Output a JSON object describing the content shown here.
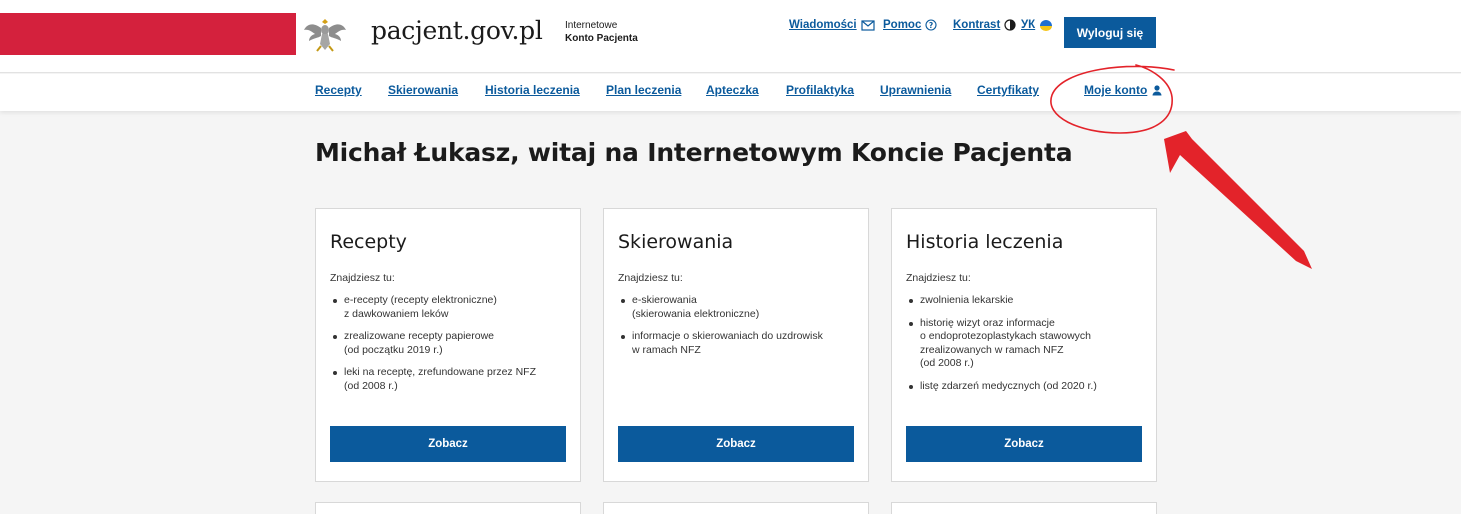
{
  "header": {
    "brand": "pacjent.gov.pl",
    "subtitle_line1": "Internetowe",
    "subtitle_line2": "Konto Pacjenta",
    "links": {
      "messages": "Wiadomości",
      "help": "Pomoc",
      "contrast": "Kontrast",
      "language": "УК"
    },
    "logout_label": "Wyloguj się",
    "brand_red": "#d4213d",
    "accent_blue": "#0b5a9c"
  },
  "nav": {
    "items": [
      {
        "label": "Recepty"
      },
      {
        "label": "Skierowania"
      },
      {
        "label": "Historia leczenia"
      },
      {
        "label": "Plan leczenia"
      },
      {
        "label": "Apteczka"
      },
      {
        "label": "Profilaktyka"
      },
      {
        "label": "Uprawnienia"
      },
      {
        "label": "Certyfikaty"
      },
      {
        "label": "Moje konto"
      }
    ]
  },
  "main": {
    "title": "Michał Łukasz, witaj na Internetowym Koncie Pacjenta",
    "cards": [
      {
        "title": "Recepty",
        "intro": "Znajdziesz tu:",
        "items": [
          "e-recepty (recepty elektroniczne)\nz dawkowaniem leków",
          "zrealizowane recepty papierowe\n(od początku 2019 r.)",
          "leki na receptę, zrefundowane przez NFZ\n(od 2008 r.)"
        ],
        "button": "Zobacz"
      },
      {
        "title": "Skierowania",
        "intro": "Znajdziesz tu:",
        "items": [
          "e-skierowania\n(skierowania elektroniczne)",
          "informacje o skierowaniach do uzdrowisk\nw ramach NFZ"
        ],
        "button": "Zobacz"
      },
      {
        "title": "Historia leczenia",
        "intro": "Znajdziesz tu:",
        "items": [
          "zwolnienia lekarskie",
          "historię wizyt oraz informacje\no endoprotezoplastykach stawowych\nzrealizowanych w ramach NFZ\n(od 2008 r.)",
          "listę zdarzeń medycznych (od 2020 r.)"
        ],
        "button": "Zobacz"
      }
    ]
  },
  "annotation": {
    "color": "#e3232a",
    "icon": "hand-drawn-circle-and-arrow"
  }
}
